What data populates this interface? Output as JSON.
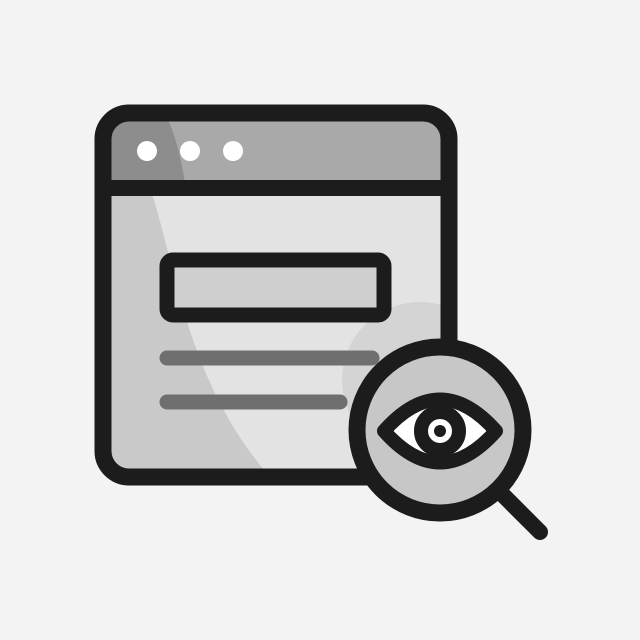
{
  "icon": {
    "name": "web-page-inspect-icon",
    "parts": [
      "browser-window-icon",
      "window-dot-icon",
      "content-box",
      "text-line",
      "magnifier-icon",
      "eye-icon"
    ]
  },
  "colors": {
    "background": "#f3f3f3",
    "outline": "#1c1c1c",
    "header_fill": "#8a8a8a",
    "body_fill": "#c9c9c9",
    "highlight_fill": "#e6e6e6",
    "content_box_fill": "#cfcfcf",
    "text_line": "#6f6f6f",
    "lens_fill": "#c7c7c7",
    "eye_fill": "#ffffff",
    "dots": "#ffffff"
  }
}
